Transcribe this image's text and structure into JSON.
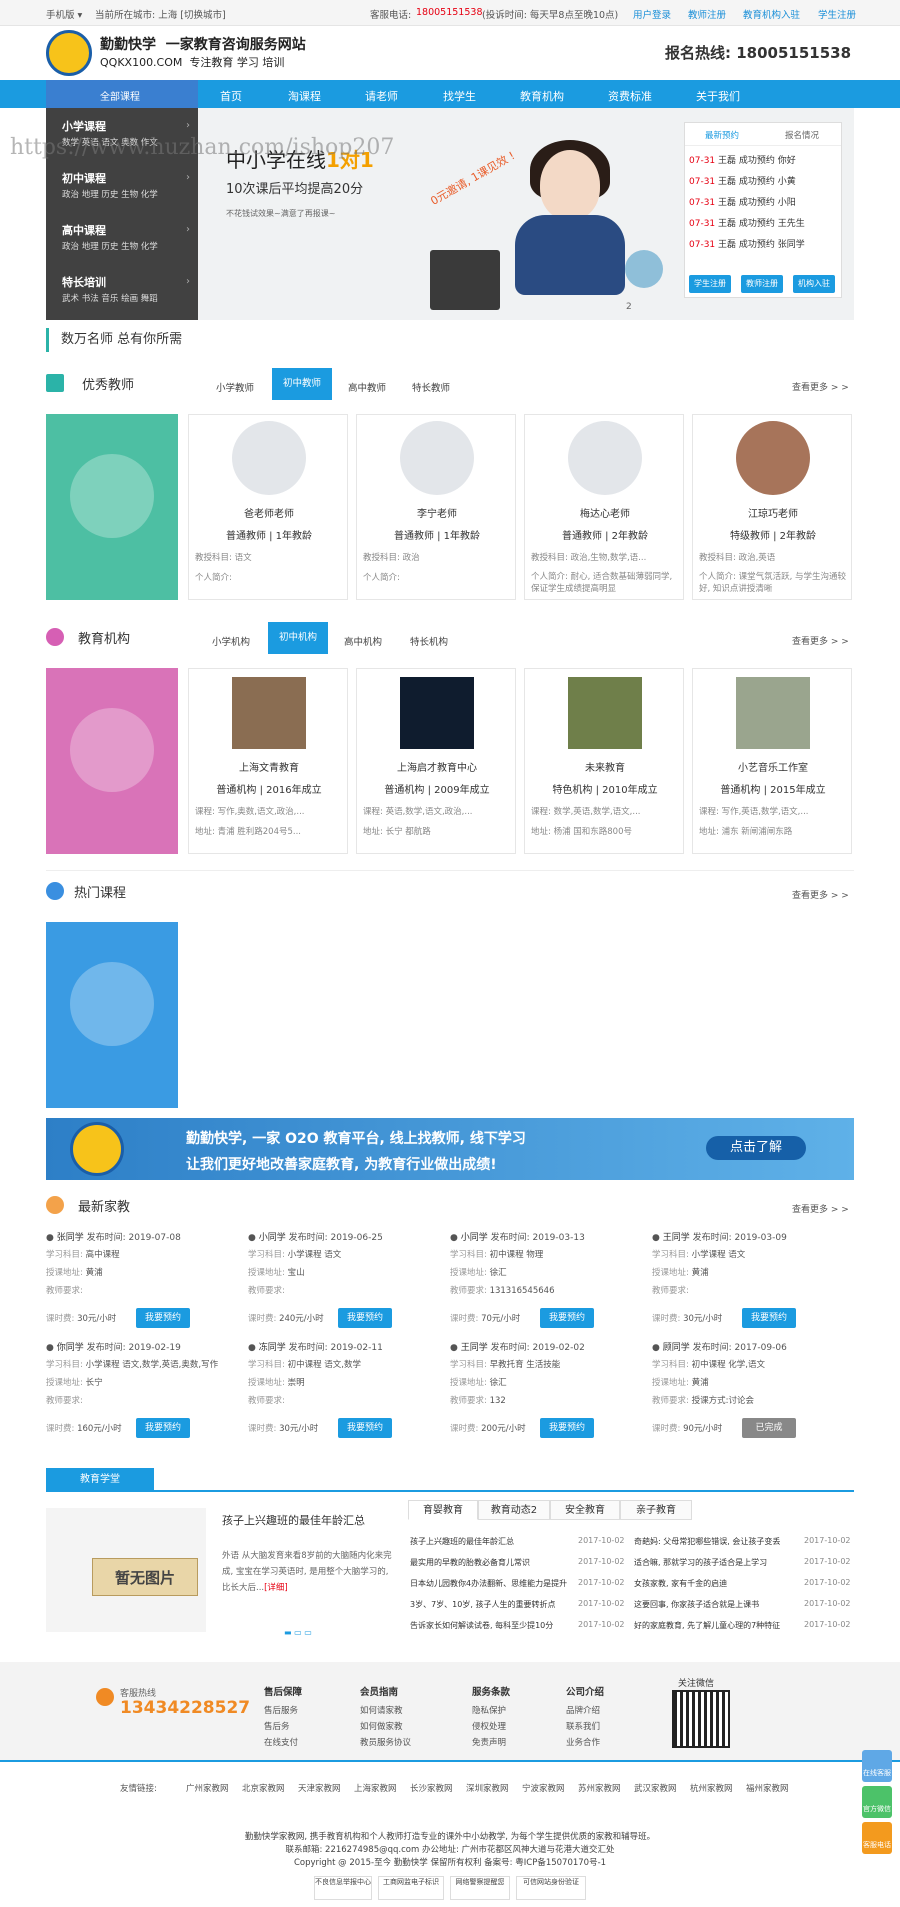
{
  "topbar": {
    "mobile": "手机版 ▾",
    "city": "当前所在城市: 上海 [切换城市]",
    "phone_label": "客服电话:",
    "phone": "18005151538",
    "hours": "(投诉时间: 每天早8点至晚10点)",
    "links": [
      "用户登录",
      "教师注册",
      "教育机构入驻",
      "学生注册"
    ]
  },
  "header": {
    "brand": "勤勤快学",
    "tag": "一家教育咨询服务网站",
    "domain": "QQKX100.COM",
    "motto": "专注教育 学习 培训",
    "hotline": "报名热线: 18005151538"
  },
  "nav": {
    "all": "全部课程",
    "items": [
      "首页",
      "淘课程",
      "请老师",
      "找学生",
      "教育机构",
      "资费标准",
      "关于我们"
    ]
  },
  "sidebar": [
    {
      "title": "小学课程",
      "subs": "数学 英语 语文 奥数 作文"
    },
    {
      "title": "初中课程",
      "subs": "政治 地理 历史 生物 化学"
    },
    {
      "title": "高中课程",
      "subs": "政治 地理 历史 生物 化学"
    },
    {
      "title": "特长培训",
      "subs": "武术 书法 音乐 绘画 舞蹈"
    }
  ],
  "banner": {
    "title_a": "中小学在线",
    "title_b": "1对1",
    "sub": "10次课后平均提高20分",
    "small": "不花钱试效果~满意了再报课~",
    "stamp": "0元邀请, 1课见效 !",
    "pager": "2",
    "watermark": "https://www.huzhan.com/ishop207"
  },
  "booking": {
    "tabs": [
      "最新预约",
      "报名情况"
    ],
    "lines": [
      {
        "d": "07-31",
        "t": "王磊 成功预约 你好"
      },
      {
        "d": "07-31",
        "t": "王磊 成功预约 小黄"
      },
      {
        "d": "07-31",
        "t": "王磊 成功预约 小阳"
      },
      {
        "d": "07-31",
        "t": "王磊 成功预约 王先生"
      },
      {
        "d": "07-31",
        "t": "王磊 成功预约 张同学"
      }
    ],
    "buttons": [
      "学生注册",
      "教师注册",
      "机构入驻"
    ]
  },
  "slogan": "数万名师 总有你所需",
  "teachers": {
    "title": "优秀教师",
    "tabs": [
      "小学教师",
      "初中教师",
      "高中教师",
      "特长教师"
    ],
    "active": 1,
    "more": "查看更多 > >",
    "cards": [
      {
        "name": "爸老师老师",
        "role": "普通教师 | 1年教龄",
        "subject": "教授科目: 语文",
        "intro": "个人简介:"
      },
      {
        "name": "李宁老师",
        "role": "普通教师 | 1年教龄",
        "subject": "教授科目: 政治",
        "intro": "个人简介:"
      },
      {
        "name": "梅达心老师",
        "role": "普通教师 | 2年教龄",
        "subject": "教授科目: 政治,生物,数学,语...",
        "intro": "个人简介: 耐心, 适合数基础薄弱同学, 保证学生成绩提高明显"
      },
      {
        "name": "江琼巧老师",
        "role": "特级教师 | 2年教龄",
        "subject": "教授科目: 政治,英语",
        "intro": "个人简介: 课堂气氛活跃, 与学生沟通较好, 知识点讲授清晰"
      }
    ]
  },
  "institutions": {
    "title": "教育机构",
    "tabs": [
      "小学机构",
      "初中机构",
      "高中机构",
      "特长机构"
    ],
    "active": 1,
    "more": "查看更多 > >",
    "cards": [
      {
        "name": "上海文青教育",
        "role": "普通机构 | 2016年成立",
        "subject": "课程: 写作,奥数,语文,政治,...",
        "intro": "地址: 青浦 胜利路204号5..."
      },
      {
        "name": "上海启才教育中心",
        "role": "普通机构 | 2009年成立",
        "subject": "课程: 英语,数学,语文,政治,...",
        "intro": "地址: 长宁 都航路"
      },
      {
        "name": "未来教育",
        "role": "特色机构 | 2010年成立",
        "subject": "课程: 数学,英语,数学,语文,...",
        "intro": "地址: 杨浦 国和东路800号"
      },
      {
        "name": "小艺音乐工作室",
        "role": "普通机构 | 2015年成立",
        "subject": "课程: 写作,英语,数学,语文,...",
        "intro": "地址: 浦东 新闸浦闸东路"
      }
    ]
  },
  "courses": {
    "title": "热门课程",
    "more": "查看更多 > >"
  },
  "cta": {
    "line1": "勤勤快学, 一家 O2O 教育平台, 线上找教师, 线下学习",
    "line2": "让我们更好地改善家庭教育, 为教育行业做出成绩!",
    "button": "点击了解"
  },
  "jobs": {
    "title": "最新家教",
    "more": "查看更多 > >",
    "items": [
      {
        "who": "张同学",
        "date": "发布时间: 2019-07-08",
        "subject": "高中课程",
        "addr": "黄浦",
        "req": "",
        "fee": "30元/小时",
        "btn": "我要预约"
      },
      {
        "who": "小同学",
        "date": "发布时间: 2019-06-25",
        "subject": "小学课程 语文",
        "addr": "宝山",
        "req": "",
        "fee": "240元/小时",
        "btn": "我要预约"
      },
      {
        "who": "小同学",
        "date": "发布时间: 2019-03-13",
        "subject": "初中课程 物理",
        "addr": "徐汇",
        "req": "131316545646",
        "fee": "70元/小时",
        "btn": "我要预约"
      },
      {
        "who": "王同学",
        "date": "发布时间: 2019-03-09",
        "subject": "小学课程 语文",
        "addr": "黄浦",
        "req": "",
        "fee": "30元/小时",
        "btn": "我要预约"
      },
      {
        "who": "你同学",
        "date": "发布时间: 2019-02-19",
        "subject": "小学课程 语文,数学,英语,奥数,写作",
        "addr": "长宁",
        "req": "",
        "fee": "160元/小时",
        "btn": "我要预约"
      },
      {
        "who": "冻同学",
        "date": "发布时间: 2019-02-11",
        "subject": "初中课程 语文,数学",
        "addr": "崇明",
        "req": "",
        "fee": "30元/小时",
        "btn": "我要预约"
      },
      {
        "who": "王同学",
        "date": "发布时间: 2019-02-02",
        "subject": "早教托育 生活技能",
        "addr": "徐汇",
        "req": "132",
        "fee": "200元/小时",
        "btn": "我要预约"
      },
      {
        "who": "顾同学",
        "date": "发布时间: 2017-09-06",
        "subject": "初中课程 化学,语文",
        "addr": "黄浦",
        "req": "授课方式:讨论会",
        "fee": "90元/小时",
        "btn": "已完成"
      }
    ],
    "labels": {
      "subject": "学习科目:",
      "addr": "授课地址:",
      "req": "教师要求:",
      "fee": "课时费:"
    }
  },
  "study": {
    "tab": "教育学堂",
    "noimg": "暂无图片",
    "art_title": "孩子上兴趣班的最佳年龄汇总",
    "art_body": "外语 从大脑发育来看8岁前的大脑随内化来完成, 宝宝在学习英语时, 是用整个大脑学习的, 比长大后...",
    "art_more": "[详细]",
    "tabs": [
      "育婴教育",
      "教育动态2",
      "安全教育",
      "亲子教育"
    ],
    "left": [
      {
        "t": "孩子上兴趣班的最佳年龄汇总",
        "d": "2017-10-02"
      },
      {
        "t": "最实用的早教的胎教必备育儿常识",
        "d": "2017-10-02"
      },
      {
        "t": "日本幼儿园教你4办法翻新、思维能力是提升",
        "d": "2017-10-02"
      },
      {
        "t": "3岁、7岁、10岁, 孩子人生的重要转折点",
        "d": "2017-10-02"
      },
      {
        "t": "告诉家长如何解读试卷, 每科至少提10分",
        "d": "2017-10-02"
      }
    ],
    "right": [
      {
        "t": "奇葩妈: 父母常犯哪些错误, 会让孩子变丢",
        "d": "2017-10-02"
      },
      {
        "t": "适合嘛, 那就学习的孩子适合是上学习",
        "d": "2017-10-02"
      },
      {
        "t": "女孩家教, 家有千金的启迪",
        "d": "2017-10-02"
      },
      {
        "t": "这要回事, 你家孩子适合就是上课书",
        "d": "2017-10-02"
      },
      {
        "t": "好的家庭教育, 先了解儿童心理的7种特征",
        "d": "2017-10-02"
      }
    ]
  },
  "footer": {
    "hotline_label": "客服热线",
    "hotline": "13434228527",
    "cols": [
      {
        "h": "售后保障",
        "l": [
          "售后服务",
          "售后务",
          "在线支付"
        ]
      },
      {
        "h": "会员指南",
        "l": [
          "如何请家教",
          "如何做家教",
          "教员服务协议"
        ]
      },
      {
        "h": "服务条款",
        "l": [
          "隐私保护",
          "侵权处理",
          "免责声明"
        ]
      },
      {
        "h": "公司介绍",
        "l": [
          "品牌介绍",
          "联系我们",
          "业务合作"
        ]
      }
    ],
    "wechat": "关注微信",
    "links_label": "友情链接:",
    "links": [
      "广州家教网",
      "北京家教网",
      "天津家教网",
      "上海家教网",
      "长沙家教网",
      "深圳家教网",
      "宁波家教网",
      "苏州家教网",
      "武汉家教网",
      "杭州家教网",
      "福州家教网"
    ],
    "desc": "勤勤快学家教网, 携手教育机构和个人教师打造专业的课外中小幼教学, 为每个学生提供优质的家教和辅导班。",
    "contact": "联系邮箱: 2216274985@qq.com   办公地址: 广州市花都区风神大道与花港大道交汇处",
    "copyright": "Copyright @ 2015-至今 勤勤快学 保留所有权利 备案号: 粤ICP备15070170号-1",
    "badges": [
      "不良信息举报中心",
      "工商网监电子标识",
      "网络警察提醒您",
      "可信网站身份验证"
    ]
  },
  "side": [
    "在线客服",
    "官方微信",
    "客服电话"
  ]
}
